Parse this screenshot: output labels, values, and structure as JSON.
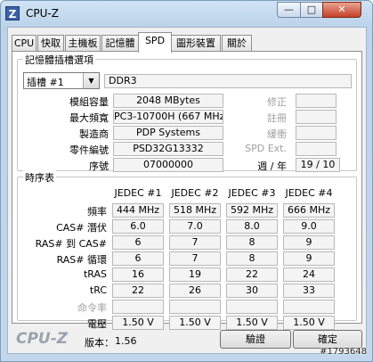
{
  "window": {
    "title": "CPU-Z",
    "app_icon_letter": "Z",
    "minimize_glyph": "—",
    "maximize_glyph": "□",
    "close_glyph": "✕"
  },
  "tabs": [
    "CPU",
    "快取",
    "主機板",
    "記憶體",
    "SPD",
    "圖形裝置",
    "關於"
  ],
  "active_tab": "SPD",
  "slot_group": {
    "title": "記憶體插槽選項",
    "slot_selected": "插槽 #1",
    "module_type": "DDR3",
    "rows": [
      {
        "label": "模組容量",
        "value": "2048 MBytes",
        "side_label": "修正",
        "side_value": ""
      },
      {
        "label": "最大頻寬",
        "value": "PC3-10700H (667 MHz)",
        "side_label": "註冊",
        "side_value": ""
      },
      {
        "label": "製造商",
        "value": "PDP Systems",
        "side_label": "緩衝",
        "side_value": ""
      },
      {
        "label": "零件編號",
        "value": "PSD32G13332",
        "side_label": "SPD Ext.",
        "side_value": ""
      },
      {
        "label": "序號",
        "value": "07000000",
        "side_label": "週 / 年",
        "side_value": "19 / 10"
      }
    ]
  },
  "timing_group": {
    "title": "時序表",
    "columns": [
      "JEDEC #1",
      "JEDEC #2",
      "JEDEC #3",
      "JEDEC #4"
    ],
    "rows": [
      {
        "label": "頻率",
        "values": [
          "444 MHz",
          "518 MHz",
          "592 MHz",
          "666 MHz"
        ]
      },
      {
        "label": "CAS# 潛伏",
        "values": [
          "6.0",
          "7.0",
          "8.0",
          "9.0"
        ]
      },
      {
        "label": "RAS# 到 CAS#",
        "values": [
          "6",
          "7",
          "8",
          "9"
        ]
      },
      {
        "label": "RAS# 循環",
        "values": [
          "6",
          "7",
          "8",
          "9"
        ]
      },
      {
        "label": "tRAS",
        "values": [
          "16",
          "19",
          "22",
          "24"
        ]
      },
      {
        "label": "tRC",
        "values": [
          "22",
          "26",
          "30",
          "33"
        ]
      },
      {
        "label": "命令率",
        "values": [
          "",
          "",
          "",
          ""
        ]
      },
      {
        "label": "電壓",
        "values": [
          "1.50 V",
          "1.50 V",
          "1.50 V",
          "1.50 V"
        ]
      }
    ]
  },
  "footer": {
    "logo": "CPU-Z",
    "version_label": "版本：",
    "version_value": "1.56",
    "validate_button": "驗證",
    "ok_button": "確定"
  },
  "watermark": "#1793648"
}
